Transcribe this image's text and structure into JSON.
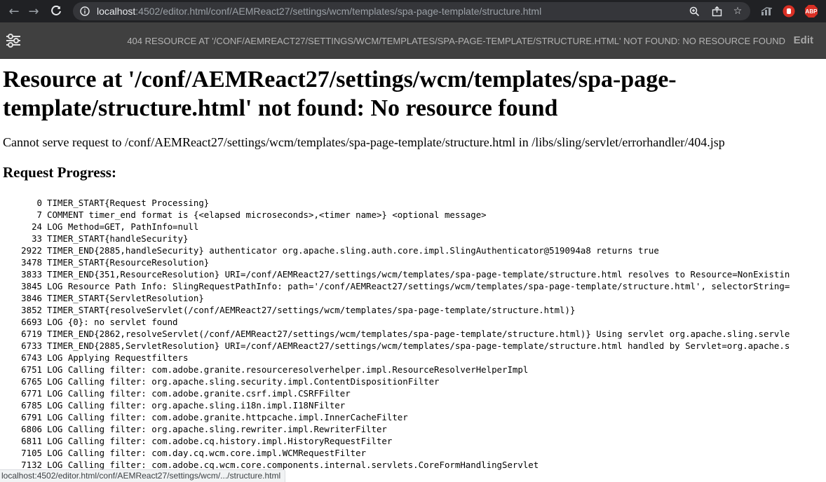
{
  "browser": {
    "url_host": "localhost",
    "url_rest": ":4502/editor.html/conf/AEMReact27/settings/wcm/templates/spa-page-template/structure.html",
    "extensions": {
      "abp_label": "ABP"
    }
  },
  "aem_toolbar": {
    "title": "404 RESOURCE AT '/CONF/AEMREACT27/SETTINGS/WCM/TEMPLATES/SPA-PAGE-TEMPLATE/STRUCTURE.HTML' NOT FOUND: NO RESOURCE FOUND",
    "edit_label": "Edit"
  },
  "page": {
    "heading": "Resource at '/conf/AEMReact27/settings/wcm/templates/spa-page-template/structure.html' not found: No resource found",
    "description": "Cannot serve request to /conf/AEMReact27/settings/wcm/templates/spa-page-template/structure.html in /libs/sling/servlet/errorhandler/404.jsp",
    "progress_heading": "Request Progress:"
  },
  "log": [
    {
      "time": "0",
      "msg": "TIMER_START{Request Processing}"
    },
    {
      "time": "7",
      "msg": "COMMENT timer_end format is {<elapsed microseconds>,<timer name>} <optional message>"
    },
    {
      "time": "24",
      "msg": "LOG Method=GET, PathInfo=null"
    },
    {
      "time": "33",
      "msg": "TIMER_START{handleSecurity}"
    },
    {
      "time": "2922",
      "msg": "TIMER_END{2885,handleSecurity} authenticator org.apache.sling.auth.core.impl.SlingAuthenticator@519094a8 returns true"
    },
    {
      "time": "3478",
      "msg": "TIMER_START{ResourceResolution}"
    },
    {
      "time": "3833",
      "msg": "TIMER_END{351,ResourceResolution} URI=/conf/AEMReact27/settings/wcm/templates/spa-page-template/structure.html resolves to Resource=NonExistin"
    },
    {
      "time": "3845",
      "msg": "LOG Resource Path Info: SlingRequestPathInfo: path='/conf/AEMReact27/settings/wcm/templates/spa-page-template/structure.html', selectorString="
    },
    {
      "time": "3846",
      "msg": "TIMER_START{ServletResolution}"
    },
    {
      "time": "3852",
      "msg": "TIMER_START{resolveServlet(/conf/AEMReact27/settings/wcm/templates/spa-page-template/structure.html)}"
    },
    {
      "time": "6693",
      "msg": "LOG {0}: no servlet found"
    },
    {
      "time": "6719",
      "msg": "TIMER_END{2862,resolveServlet(/conf/AEMReact27/settings/wcm/templates/spa-page-template/structure.html)} Using servlet org.apache.sling.servle"
    },
    {
      "time": "6733",
      "msg": "TIMER_END{2885,ServletResolution} URI=/conf/AEMReact27/settings/wcm/templates/spa-page-template/structure.html handled by Servlet=org.apache.s"
    },
    {
      "time": "6743",
      "msg": "LOG Applying Requestfilters"
    },
    {
      "time": "6751",
      "msg": "LOG Calling filter: com.adobe.granite.resourceresolverhelper.impl.ResourceResolverHelperImpl"
    },
    {
      "time": "6765",
      "msg": "LOG Calling filter: org.apache.sling.security.impl.ContentDispositionFilter"
    },
    {
      "time": "6771",
      "msg": "LOG Calling filter: com.adobe.granite.csrf.impl.CSRFFilter"
    },
    {
      "time": "6785",
      "msg": "LOG Calling filter: org.apache.sling.i18n.impl.I18NFilter"
    },
    {
      "time": "6791",
      "msg": "LOG Calling filter: com.adobe.granite.httpcache.impl.InnerCacheFilter"
    },
    {
      "time": "6806",
      "msg": "LOG Calling filter: org.apache.sling.rewriter.impl.RewriterFilter"
    },
    {
      "time": "6811",
      "msg": "LOG Calling filter: com.adobe.cq.history.impl.HistoryRequestFilter"
    },
    {
      "time": "7105",
      "msg": "LOG Calling filter: com.day.cq.wcm.core.impl.WCMRequestFilter"
    },
    {
      "time": "7132",
      "msg": "LOG Calling filter: com.adobe.cq.wcm.core.components.internal.servlets.CoreFormHandlingServlet"
    }
  ],
  "status_bar": {
    "text": "localhost:4502/editor.html/conf/AEMReact27/settings/wcm/.../structure.html"
  }
}
